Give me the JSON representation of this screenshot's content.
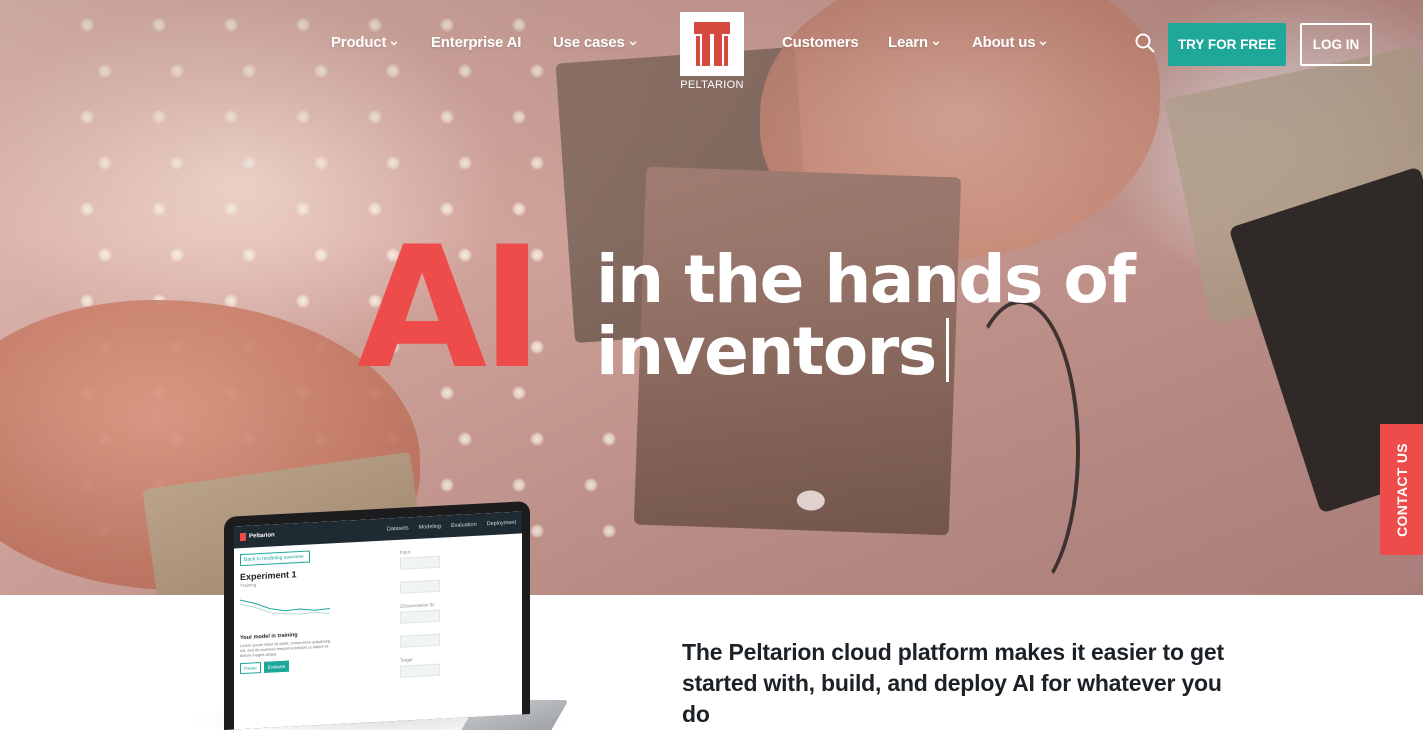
{
  "nav": {
    "items": [
      {
        "label": "Product",
        "has_dropdown": true
      },
      {
        "label": "Enterprise AI",
        "has_dropdown": false
      },
      {
        "label": "Use cases",
        "has_dropdown": true
      },
      {
        "label": "Customers",
        "has_dropdown": false
      },
      {
        "label": "Learn",
        "has_dropdown": true
      },
      {
        "label": "About us",
        "has_dropdown": true
      }
    ],
    "logo_text": "PELTARION",
    "search_icon": "search-icon",
    "try_label": "TRY FOR FREE",
    "login_label": "LOG IN"
  },
  "hero": {
    "accent": "AI",
    "line1": "in the hands of",
    "line2": "inventors"
  },
  "contact_tab": "CONTACT US",
  "laptop_app": {
    "brand": "Peltarion",
    "tabs": [
      "Datasets",
      "Modeling",
      "Evaluation",
      "Deployment"
    ],
    "back_label": "Back to modeling overview",
    "experiment_title": "Experiment 1",
    "experiment_sub": "Training",
    "training_title": "Your model is training",
    "training_body": "Lorem ipsum dolor sit amet, consectetur adipiscing elit, sed do eiusmod tempor incididunt ut labore et dolore magna aliqua.",
    "pause_label": "Pause",
    "evaluate_label": "Evaluate",
    "node_input": "Input",
    "node_dense": "2Dconvolution 3x",
    "node_target": "Target"
  },
  "tagline": "The Peltarion cloud platform makes it easier to get started with, build, and deploy AI for whatever you do",
  "colors": {
    "accent_red": "#ee4b4b",
    "teal": "#1fa89a",
    "text_dark": "#1b2126"
  }
}
